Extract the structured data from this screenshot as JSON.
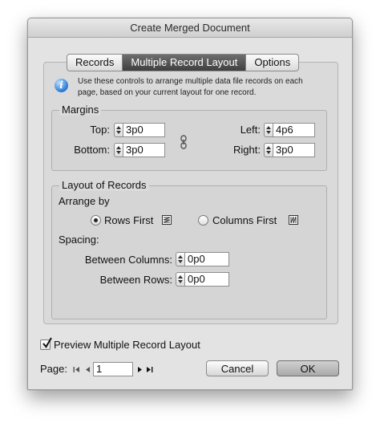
{
  "window": {
    "title": "Create Merged Document"
  },
  "tabs": [
    {
      "label": "Records",
      "active": false
    },
    {
      "label": "Multiple Record Layout",
      "active": true
    },
    {
      "label": "Options",
      "active": false
    }
  ],
  "info": {
    "icon": "info-icon",
    "text": "Use these controls to arrange multiple data file records on each page, based on your current layout for one record."
  },
  "margins": {
    "title": "Margins",
    "top": {
      "label": "Top:",
      "value": "3p0"
    },
    "bottom": {
      "label": "Bottom:",
      "value": "3p0"
    },
    "left": {
      "label": "Left:",
      "value": "4p6"
    },
    "right": {
      "label": "Right:",
      "value": "3p0"
    },
    "link_icon": "chain-link-icon"
  },
  "layout_of_records": {
    "title": "Layout of Records",
    "arrange_by_label": "Arrange by",
    "rows_first": {
      "label": "Rows First",
      "selected": true
    },
    "columns_first": {
      "label": "Columns First",
      "selected": false
    },
    "spacing_label": "Spacing:",
    "between_columns": {
      "label": "Between Columns:",
      "value": "0p0"
    },
    "between_rows": {
      "label": "Between Rows:",
      "value": "0p0"
    }
  },
  "preview": {
    "label": "Preview Multiple Record Layout",
    "checked": true
  },
  "page_nav": {
    "label": "Page:",
    "value": "1"
  },
  "buttons": {
    "cancel": "Cancel",
    "ok": "OK"
  }
}
